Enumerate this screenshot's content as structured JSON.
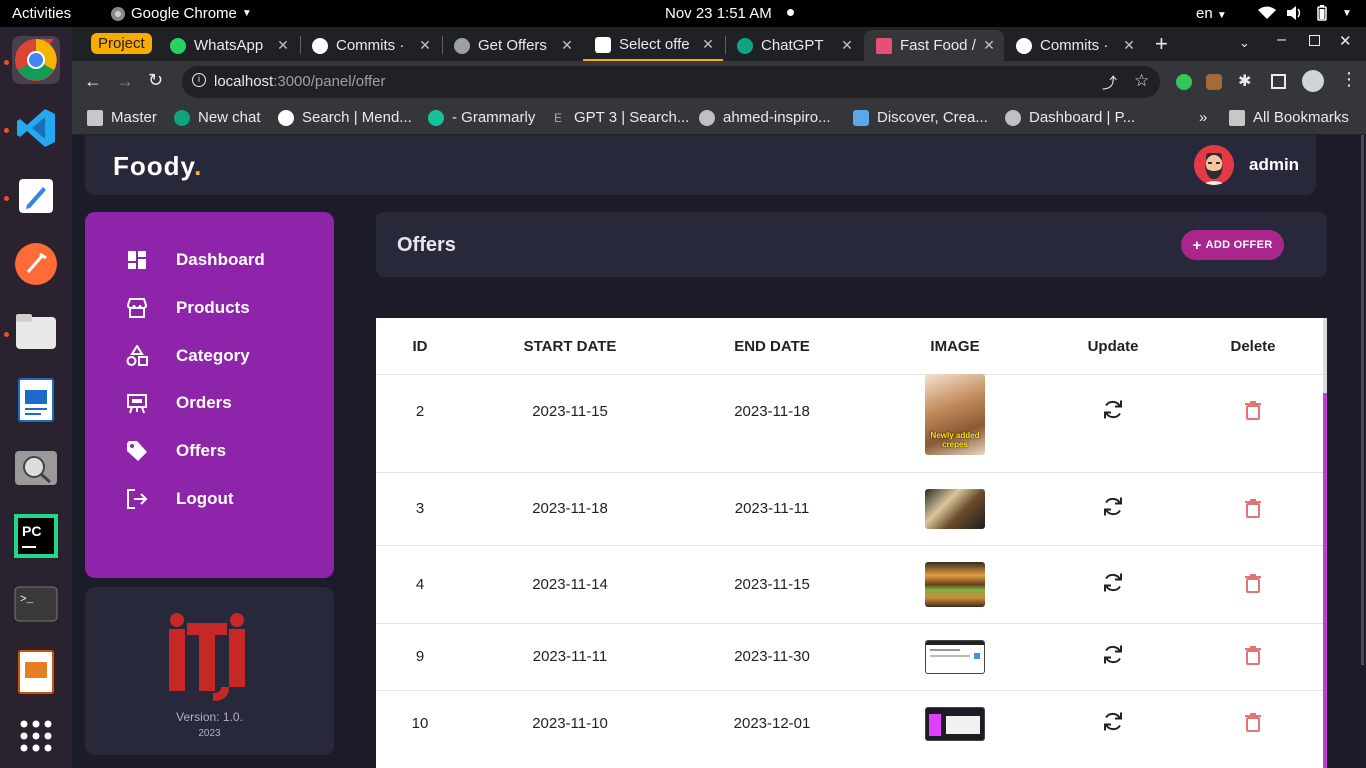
{
  "system": {
    "activities": "Activities",
    "app_name": "Google Chrome",
    "clock": "Nov 23  1:51 AM",
    "lang": "en"
  },
  "tabs": [
    {
      "label": "Project"
    },
    {
      "label": "WhatsApp"
    },
    {
      "label": "Commits ·"
    },
    {
      "label": "Get Offers"
    },
    {
      "label": "Select offe"
    },
    {
      "label": "ChatGPT"
    },
    {
      "label": "Fast Food /"
    },
    {
      "label": "Commits ·"
    }
  ],
  "address": {
    "url_host": "localhost",
    "url_rest": ":3000/panel/offer"
  },
  "bookmarks": {
    "items": [
      {
        "label": "Master"
      },
      {
        "label": "New chat"
      },
      {
        "label": "Search | Mend..."
      },
      {
        "label": "- Grammarly"
      },
      {
        "label": "GPT 3 | Search..."
      },
      {
        "label": "ahmed-inspiro..."
      },
      {
        "label": "Discover, Crea..."
      },
      {
        "label": "Dashboard | P..."
      }
    ],
    "more": "»",
    "all": "All Bookmarks"
  },
  "app": {
    "brand": "Foody",
    "brand_dot": ".",
    "user": "admin",
    "nav": [
      {
        "label": "Dashboard",
        "icon": "dashboard-icon"
      },
      {
        "label": "Products",
        "icon": "store-icon"
      },
      {
        "label": "Category",
        "icon": "category-icon"
      },
      {
        "label": "Orders",
        "icon": "orders-icon"
      },
      {
        "label": "Offers",
        "icon": "tag-icon"
      },
      {
        "label": "Logout",
        "icon": "logout-icon"
      }
    ],
    "logo_version": "Version: 1.0.",
    "logo_year": "2023",
    "page_title": "Offers",
    "add_button": "ADD OFFER"
  },
  "table": {
    "headers": [
      "ID",
      "START DATE",
      "END DATE",
      "IMAGE",
      "Update",
      "Delete"
    ],
    "rows": [
      {
        "id": "2",
        "start": "2023-11-15",
        "end": "2023-11-18",
        "image_caption": "Newly added crepes"
      },
      {
        "id": "3",
        "start": "2023-11-18",
        "end": "2023-11-11",
        "image_caption": ""
      },
      {
        "id": "4",
        "start": "2023-11-14",
        "end": "2023-11-15",
        "image_caption": ""
      },
      {
        "id": "9",
        "start": "2023-11-11",
        "end": "2023-11-30",
        "image_caption": ""
      },
      {
        "id": "10",
        "start": "2023-11-10",
        "end": "2023-12-01",
        "image_caption": ""
      }
    ]
  },
  "colors": {
    "sidebar": "#8e24aa",
    "accent_button": "#a9268c",
    "delete": "#e57373",
    "brand_dot": "#f5b82e"
  }
}
